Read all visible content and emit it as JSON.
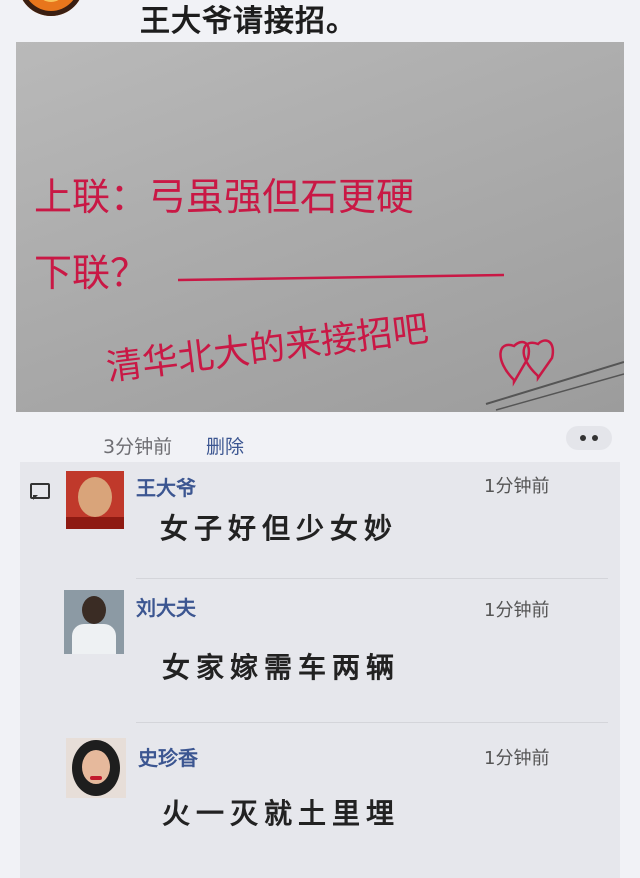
{
  "post": {
    "text": "王大爷请接招。",
    "photo": {
      "line1": "上联：弓虽强但石更硬",
      "line2": "下联？",
      "line3": "清华北大的来接招吧"
    },
    "time": "3分钟前",
    "delete_label": "删除"
  },
  "comments": [
    {
      "name": "王大爷",
      "time": "1分钟前",
      "text": "女子好但少女妙"
    },
    {
      "name": "刘大夫",
      "time": "1分钟前",
      "text": "女家嫁需车两辆"
    },
    {
      "name": "史珍香",
      "time": "1分钟前",
      "text": "火一灭就土里埋"
    }
  ],
  "icons": [
    "avatar",
    "comment-icon",
    "more-icon",
    "heart-icon"
  ],
  "colors": {
    "name_blue": "#3c5691",
    "ink_red": "#c91845",
    "accent_orange": "#e8761c"
  }
}
